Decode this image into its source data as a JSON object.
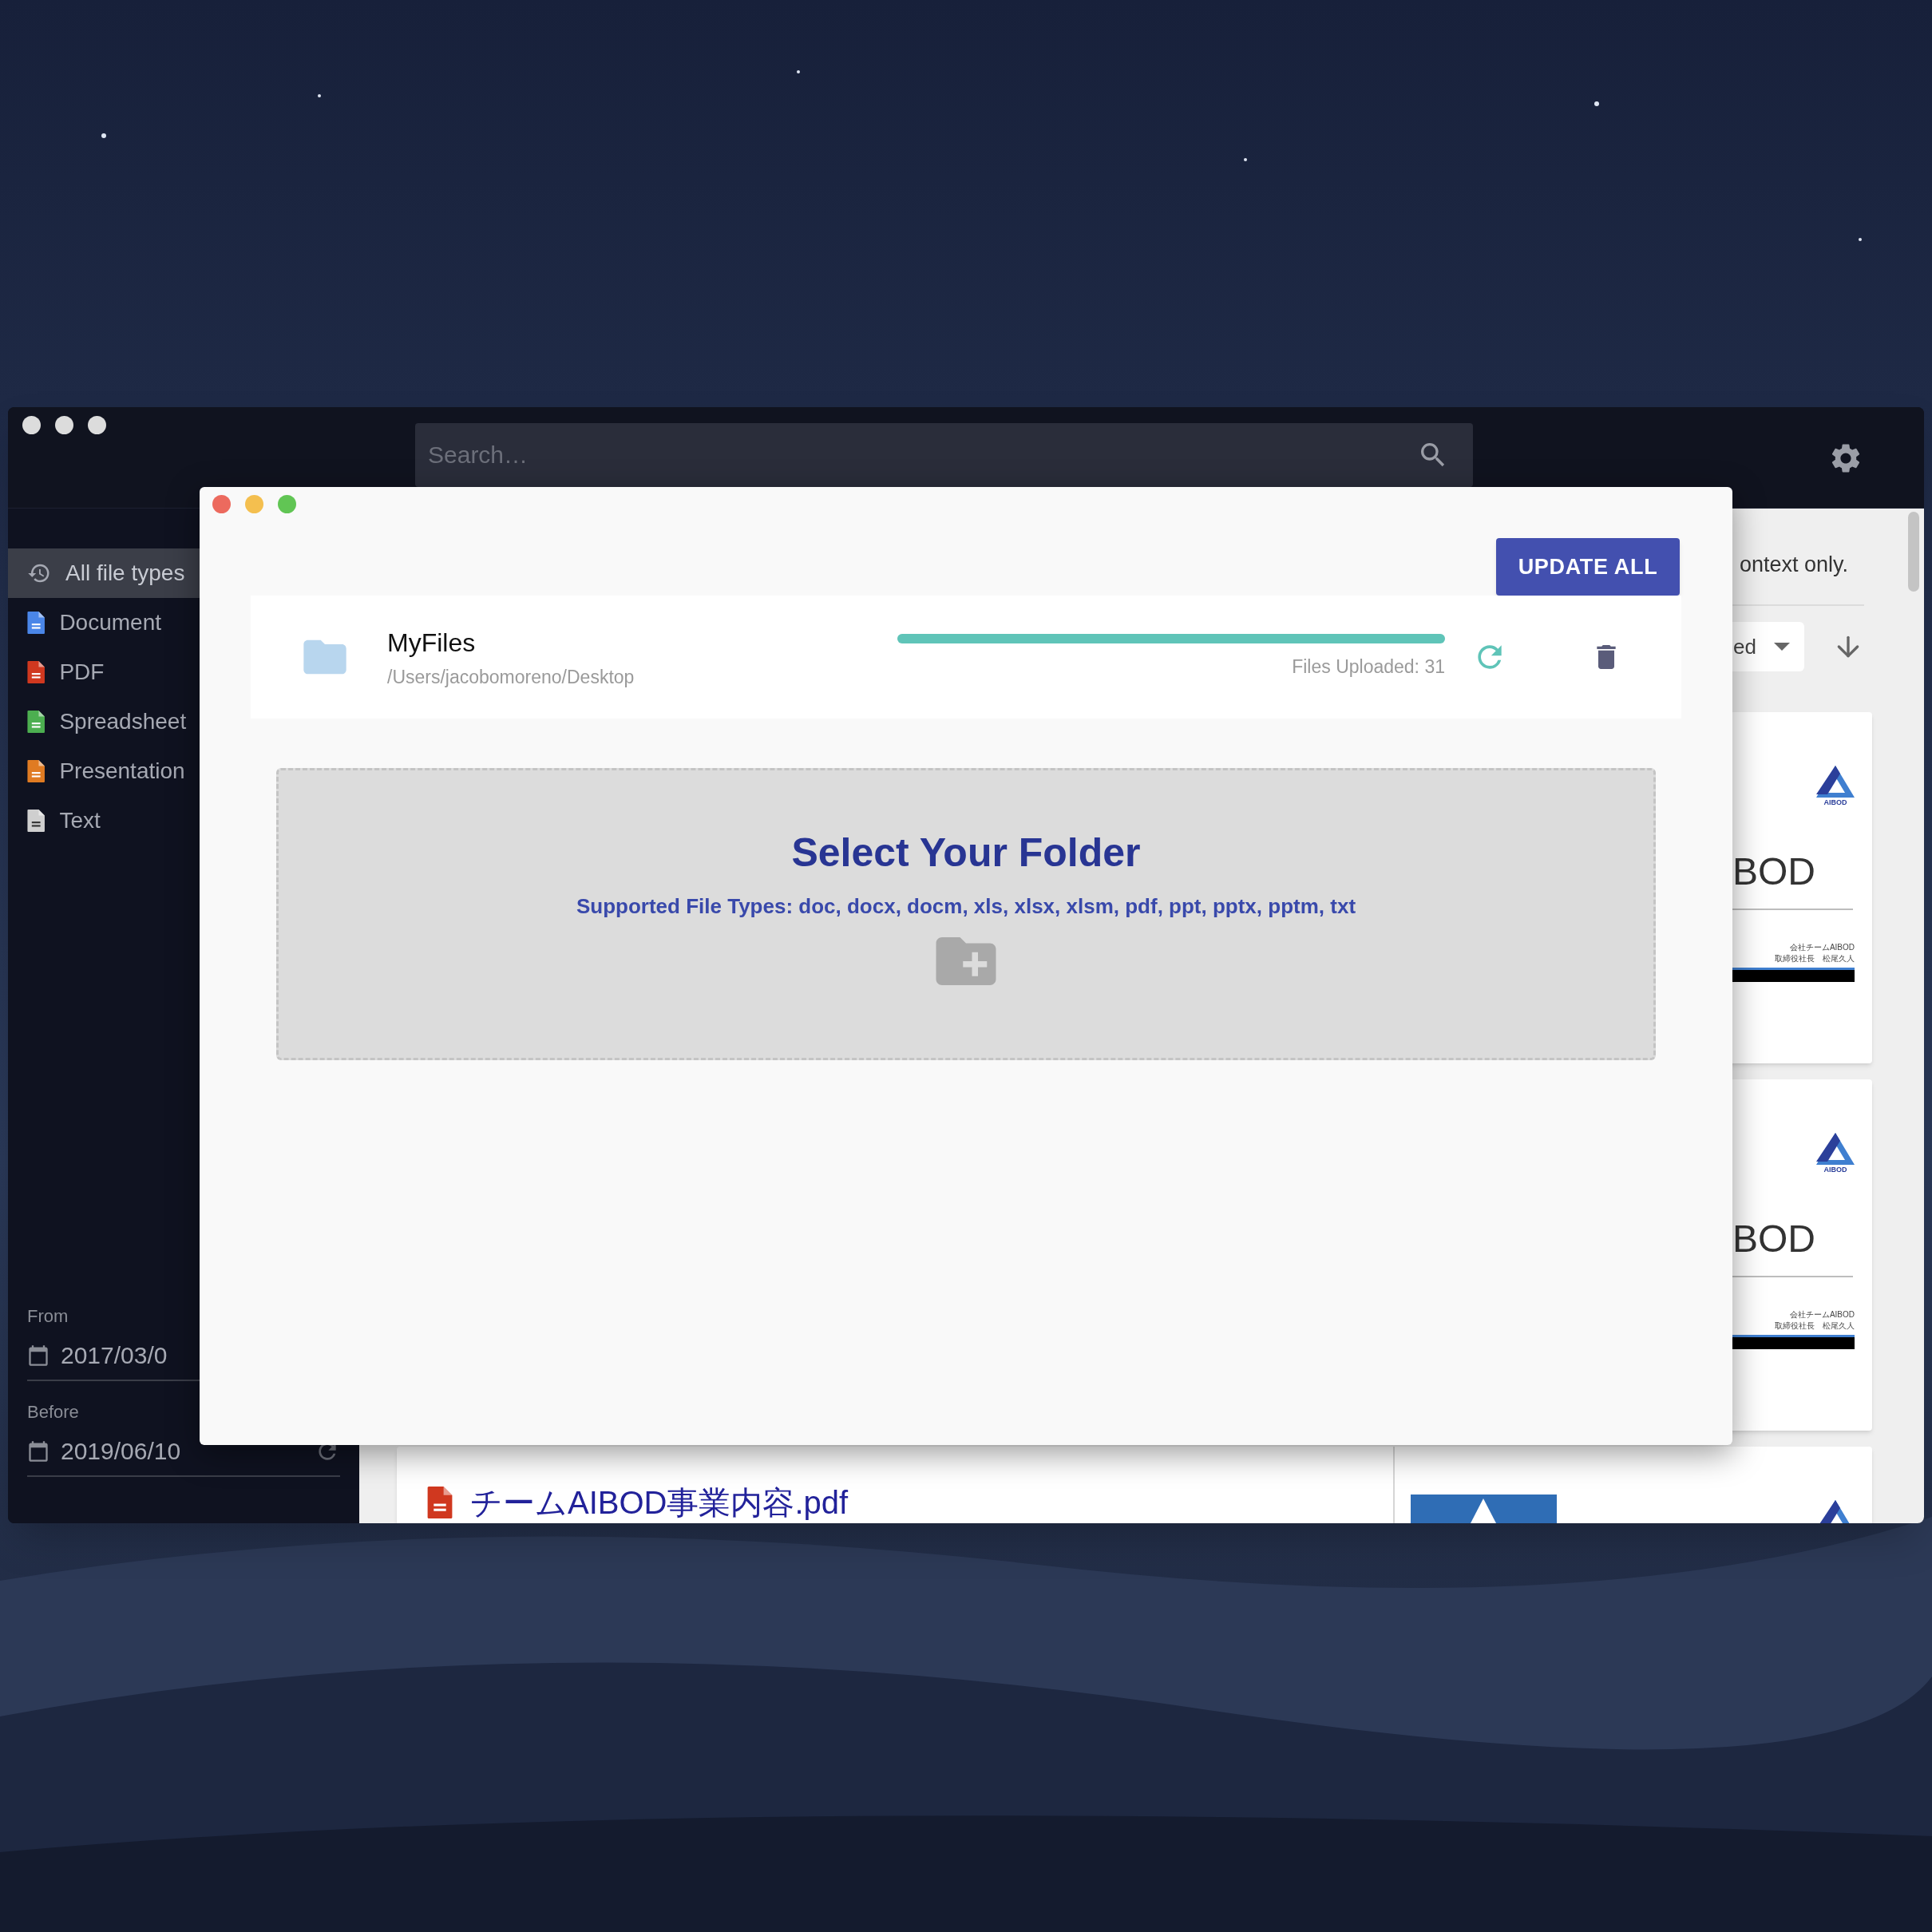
{
  "main_window": {
    "search": {
      "placeholder": "Search…"
    },
    "sidebar": {
      "file_types": [
        {
          "label": "All file types",
          "kind": "all",
          "selected": true
        },
        {
          "label": "Document",
          "kind": "document",
          "selected": false
        },
        {
          "label": "PDF",
          "kind": "pdf",
          "selected": false
        },
        {
          "label": "Spreadsheet",
          "kind": "spreadsheet",
          "selected": false
        },
        {
          "label": "Presentation",
          "kind": "presentation",
          "selected": false
        },
        {
          "label": "Text",
          "kind": "text",
          "selected": false
        }
      ],
      "from": {
        "label": "From",
        "value": "2017/03/0"
      },
      "before": {
        "label": "Before",
        "value": "2019/06/10"
      }
    },
    "content": {
      "hint": "ontext only.",
      "sort": {
        "value": "ed"
      },
      "cards": [
        {
          "preview": {
            "logo_text": "AIBOD",
            "heading": "BOD",
            "lines": [
              "会社チームAIBOD",
              "取締役社長　松尾久人"
            ]
          }
        },
        {
          "preview": {
            "logo_text": "AIBOD",
            "heading": "BOD",
            "lines": [
              "会社チームAIBOD",
              "取締役社長　松尾久人"
            ]
          }
        },
        {
          "title": "チームAIBOD事業内容.pdf",
          "kind": "pdf"
        }
      ]
    }
  },
  "dialog": {
    "button": "UPDATE ALL",
    "folder": {
      "name": "MyFiles",
      "path": "/Users/jacobomoreno/Desktop",
      "level": 1,
      "status": "Files Uploaded: 31"
    },
    "dropzone": {
      "title": "Select Your Folder",
      "subtitle": "Supported File Types: doc, docx, docm, xls, xlsx, xlsm, pdf, ppt, pptx, pptm, txt"
    }
  }
}
